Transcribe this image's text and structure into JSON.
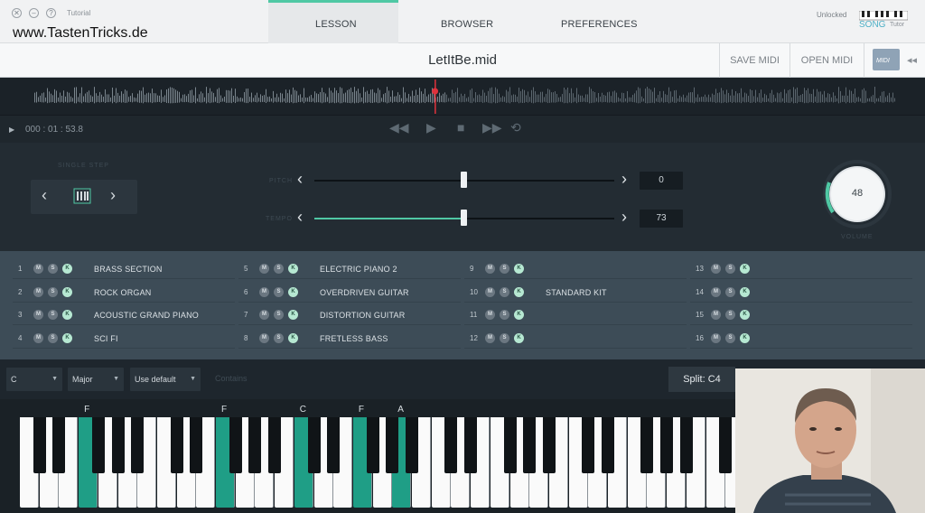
{
  "window": {
    "title": "Tutorial"
  },
  "watermark": "www.TastenTricks.de",
  "nav": {
    "tabs": [
      "LESSON",
      "BROWSER",
      "PREFERENCES"
    ],
    "status": "Unlocked",
    "logo": "SONG",
    "logo_sub": "Tutor"
  },
  "file": {
    "name": "LetItBe.mid",
    "save_label": "SAVE MIDI",
    "open_label": "OPEN MIDI",
    "folder_label": "MIDI"
  },
  "transport": {
    "time": "000 : 01 : 53.8",
    "position": 0.465
  },
  "single_step": {
    "label": "SINGLE STEP"
  },
  "pitch": {
    "label": "PITCH",
    "value": "0",
    "level": 0.5
  },
  "tempo": {
    "label": "TEMPO",
    "value": "73",
    "level": 0.5
  },
  "volume": {
    "label": "VOLUME",
    "value": "48"
  },
  "tracks": [
    {
      "num": "1",
      "name": "BRASS SECTION"
    },
    {
      "num": "2",
      "name": "ROCK ORGAN"
    },
    {
      "num": "3",
      "name": "ACOUSTIC GRAND PIANO"
    },
    {
      "num": "4",
      "name": "SCI FI"
    },
    {
      "num": "5",
      "name": "ELECTRIC PIANO 2"
    },
    {
      "num": "6",
      "name": "OVERDRIVEN GUITAR"
    },
    {
      "num": "7",
      "name": "DISTORTION GUITAR"
    },
    {
      "num": "8",
      "name": "FRETLESS BASS"
    },
    {
      "num": "9",
      "name": ""
    },
    {
      "num": "10",
      "name": "STANDARD KIT"
    },
    {
      "num": "11",
      "name": ""
    },
    {
      "num": "12",
      "name": ""
    },
    {
      "num": "13",
      "name": ""
    },
    {
      "num": "14",
      "name": ""
    },
    {
      "num": "15",
      "name": ""
    },
    {
      "num": "16",
      "name": ""
    }
  ],
  "track_buttons": [
    "M",
    "S",
    "K"
  ],
  "key_settings": {
    "key": "C",
    "scale": "Major",
    "fingering": "Use default",
    "extra": "Contains",
    "split": "Split: C4"
  },
  "chord_labels": [
    "F",
    "F",
    "C",
    "F",
    "A"
  ],
  "colors": {
    "accent": "#4fc8a4",
    "highlight_key": "#1f9e86",
    "playhead": "#e0323c"
  }
}
